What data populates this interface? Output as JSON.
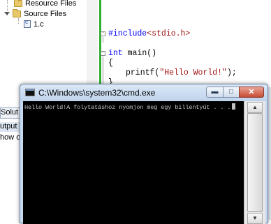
{
  "solution_explorer": {
    "resource_files": "Resource Files",
    "source_files": "Source Files",
    "file_1c": "1.c"
  },
  "editor": {
    "line_include_directive": "#include",
    "line_include_header": "<stdio.h>",
    "line_main_kw": "int",
    "line_main_rest": " main()",
    "line_open_brace": "{",
    "line_printf_fn": "printf(",
    "line_printf_str": "\"Hello World!\"",
    "line_printf_end": ");",
    "line_close_brace": "}"
  },
  "side_tabs": {
    "solution": "Solut",
    "output": "utput",
    "show": "how o"
  },
  "cmd": {
    "title": "C:\\Windows\\system32\\cmd.exe",
    "output_text": "Hello World!A folytatáshoz nyomjon meg egy billentyűt . . .",
    "minimize_glyph": "▬",
    "maximize_glyph": "□",
    "close_glyph": "✕",
    "scroll_up_glyph": "▲",
    "scroll_down_glyph": "▼"
  },
  "colors": {
    "keyword": "#0000ff",
    "string": "#a31515",
    "console_bg": "#000000",
    "console_text": "#c0c0c0",
    "change_bar": "#30b030"
  }
}
